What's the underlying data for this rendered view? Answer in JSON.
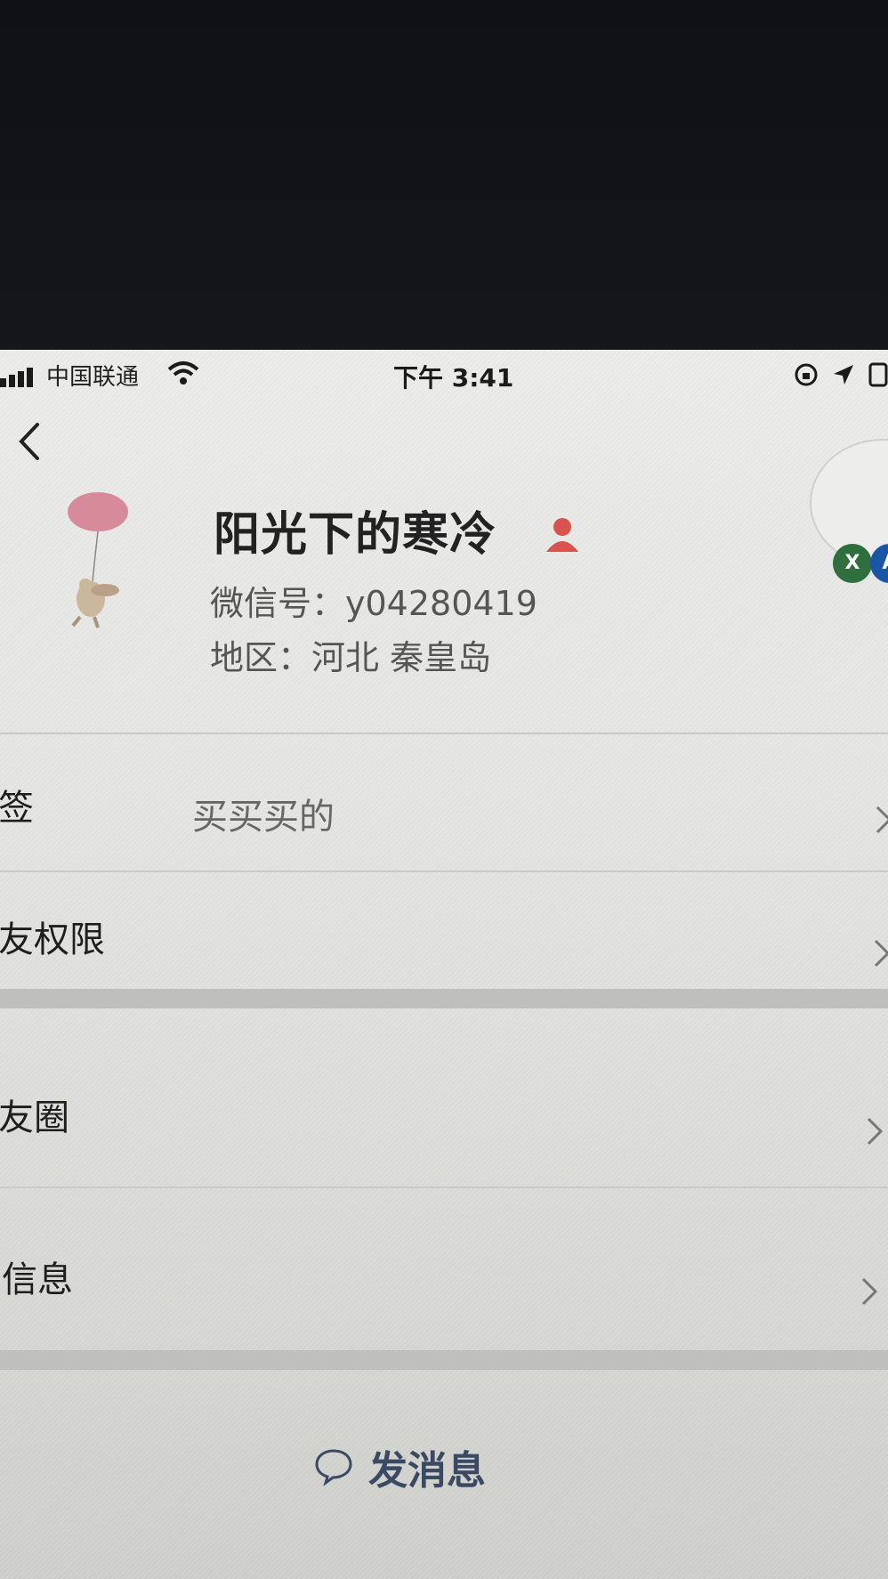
{
  "status_bar": {
    "carrier": "中国联通",
    "time": "下午 3:41"
  },
  "profile": {
    "name": "阳光下的寒冷",
    "wechat_id": "微信号：y04280419",
    "region": "地区：河北 秦皇岛",
    "gender_icon": "female-user-icon",
    "badge_left": "X",
    "badge_right": "A"
  },
  "rows": [
    {
      "label": "标签",
      "value": "买买买的"
    },
    {
      "label": "朋友权限",
      "value": ""
    },
    {
      "label": "朋友圈",
      "value": ""
    },
    {
      "label": "更多信息",
      "value": ""
    }
  ],
  "actions": {
    "send_message": "发消息"
  },
  "colors": {
    "screen_bg": "#e4e4e2",
    "dark_bg": "#0e0f12",
    "accent_red": "#d9534f",
    "send_text": "#3a4a63"
  }
}
